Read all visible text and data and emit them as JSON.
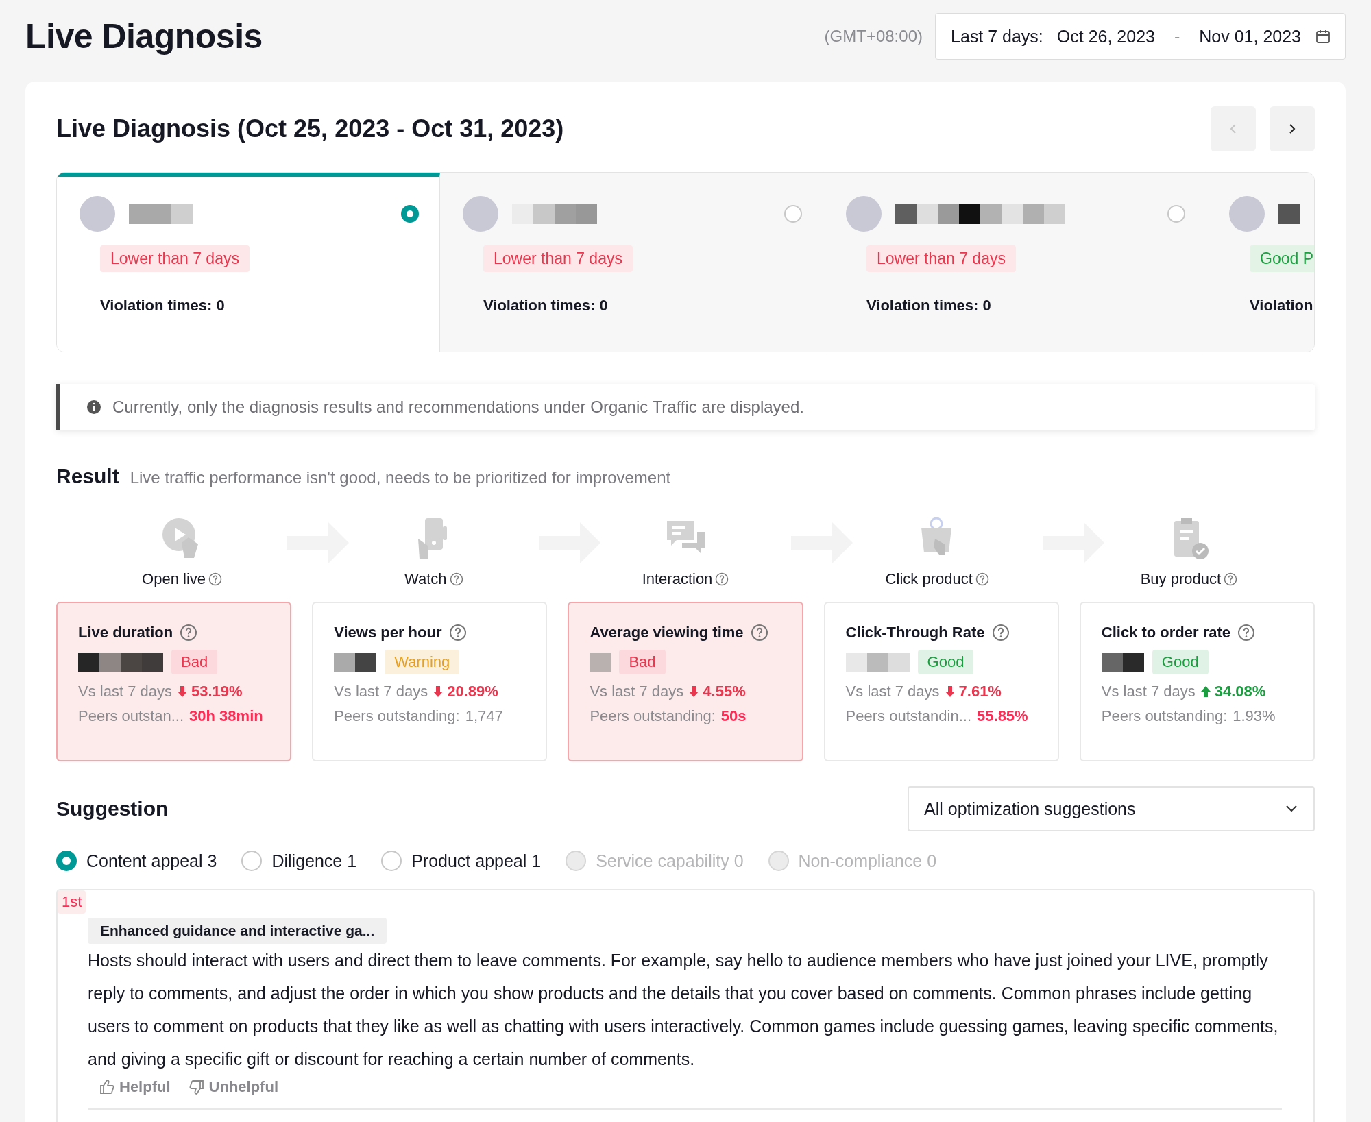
{
  "header": {
    "title": "Live Diagnosis",
    "timezone": "(GMT+08:00)",
    "date_range": {
      "label": "Last 7 days:",
      "start": "Oct 26, 2023",
      "separator": "-",
      "end": "Nov 01, 2023"
    }
  },
  "panel": {
    "title": "Live Diagnosis (Oct 25, 2023 - Oct 31, 2023)",
    "prev_disabled": true,
    "next_disabled": false
  },
  "hosts": [
    {
      "selected": true,
      "status": "Lower than 7 days",
      "good": false,
      "violations": "Violation times: 0"
    },
    {
      "selected": false,
      "status": "Lower than 7 days",
      "good": false,
      "violations": "Violation times: 0"
    },
    {
      "selected": false,
      "status": "Lower than 7 days",
      "good": false,
      "violations": "Violation times: 0"
    },
    {
      "selected": false,
      "status": "Good P",
      "good": true,
      "violations": "Violation"
    }
  ],
  "notice": "Currently, only the diagnosis results and recommendations under Organic Traffic are displayed.",
  "result": {
    "label": "Result",
    "summary": "Live traffic performance isn't good, needs to be prioritized for improvement"
  },
  "funnel": [
    {
      "label": "Open live"
    },
    {
      "label": "Watch"
    },
    {
      "label": "Interaction"
    },
    {
      "label": "Click product"
    },
    {
      "label": "Buy product"
    }
  ],
  "metrics": [
    {
      "title": "Live duration",
      "status": "Bad",
      "kind": "bad",
      "compare_label": "Vs last 7 days",
      "trend_up": false,
      "change": "53.19%",
      "peers_label": "Peers outstan...",
      "peers_value": "30h 38min",
      "peers_highlight": true
    },
    {
      "title": "Views per hour",
      "status": "Warning",
      "kind": "warning",
      "compare_label": "Vs last 7 days",
      "trend_up": false,
      "change": "20.89%",
      "peers_label": "Peers outstanding:",
      "peers_value": "1,747",
      "peers_highlight": false
    },
    {
      "title": "Average viewing time",
      "status": "Bad",
      "kind": "bad",
      "compare_label": "Vs last 7 days",
      "trend_up": false,
      "change": "4.55%",
      "peers_label": "Peers outstanding:",
      "peers_value": "50s",
      "peers_highlight": true
    },
    {
      "title": "Click-Through Rate",
      "status": "Good",
      "kind": "good",
      "compare_label": "Vs last 7 days",
      "trend_up": false,
      "change": "7.61%",
      "peers_label": "Peers outstandin...",
      "peers_value": "55.85%",
      "peers_highlight": true
    },
    {
      "title": "Click to order rate",
      "status": "Good",
      "kind": "good",
      "compare_label": "Vs last 7 days",
      "trend_up": true,
      "change": "34.08%",
      "peers_label": "Peers outstanding:",
      "peers_value": "1.93%",
      "peers_highlight": false
    }
  ],
  "suggestion": {
    "title": "Suggestion",
    "filter": "All optimization suggestions",
    "categories": [
      {
        "label": "Content appeal 3",
        "selected": true,
        "disabled": false
      },
      {
        "label": "Diligence 1",
        "selected": false,
        "disabled": false
      },
      {
        "label": "Product appeal 1",
        "selected": false,
        "disabled": false
      },
      {
        "label": "Service capability 0",
        "selected": false,
        "disabled": true
      },
      {
        "label": "Non-compliance 0",
        "selected": false,
        "disabled": true
      }
    ],
    "items": [
      {
        "rank": "1st",
        "tag": "Enhanced guidance and interactive ga...",
        "text": "Hosts should interact with users and direct them to leave comments. For example, say hello to audience members who have just joined your LIVE, promptly reply to comments, and adjust the order in which you show products and the details that you cover based on comments. Common phrases include getting users to comment on products that they like as well as chatting with users interactively. Common games include guessing games, leaving specific comments, and giving a specific gift or discount for reaching a certain number of comments.",
        "helpful": "Helpful",
        "unhelpful": "Unhelpful"
      }
    ]
  }
}
